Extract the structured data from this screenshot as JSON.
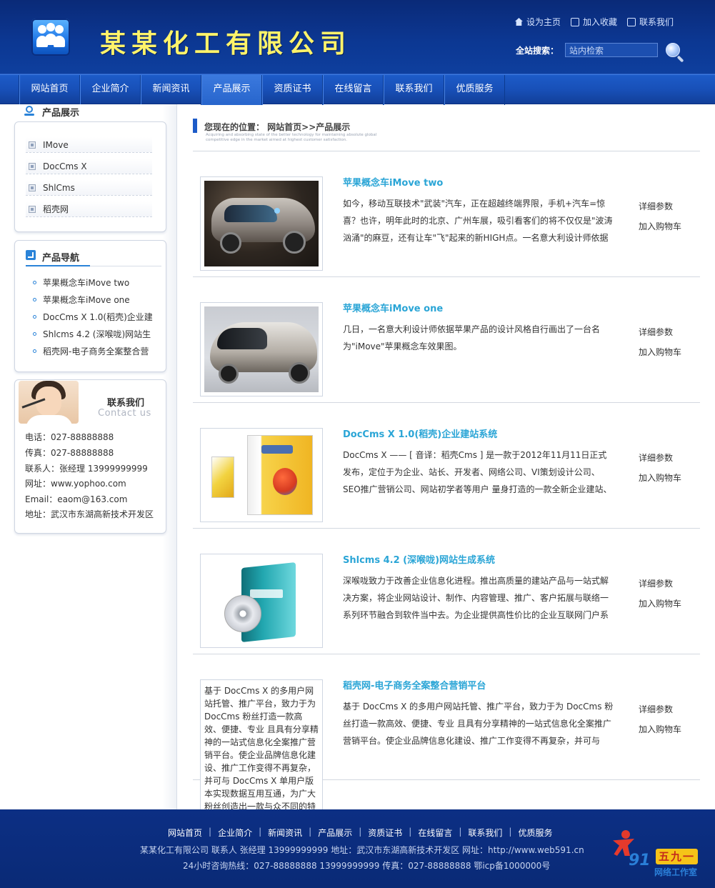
{
  "header": {
    "site_title": "某某化工有限公司",
    "top_links": [
      "设为主页",
      "加入收藏",
      "联系我们"
    ],
    "search_label": "全站搜索：",
    "search_placeholder": "站内检索"
  },
  "nav": {
    "items": [
      "网站首页",
      "企业简介",
      "新闻资讯",
      "产品展示",
      "资质证书",
      "在线留言",
      "联系我们",
      "优质服务"
    ],
    "active": "产品展示"
  },
  "sidebar": {
    "products_title": "产品展示",
    "categories": [
      "IMove",
      "DocCms X",
      "ShlCms",
      "稻壳网"
    ],
    "nav_title": "产品导航",
    "nav_items": [
      "苹果概念车iMove two",
      "苹果概念车iMove one",
      "DocCms X 1.0(稻壳)企业建",
      "Shlcms 4.2 (深喉咙)网站生",
      "稻壳网-电子商务全案整合营"
    ],
    "contact_title": "联系我们",
    "contact_subtitle": "Contact us",
    "contact_lines": [
      "电话：027-88888888",
      "传真：027-88888888",
      "联系人：张经理 13999999999",
      "网址：www.yophoo.com",
      "Email：eaom@163.com",
      "地址：武汉市东湖高新技术开发区"
    ]
  },
  "main": {
    "breadcrumb": "您现在的位置： 网站首页>>产品展示",
    "tagline": "Acquiring and absorbing state of the better technology for maintaining absolute global competitive edge in the market aimed at highest customer satisfaction.",
    "detail_label": "详细参数",
    "cart_label": "加入购物车",
    "products": [
      {
        "title": "苹果概念车iMove two",
        "desc": "如今，移动互联技术\"武装\"汽车，正在超越终端界限，手机+汽车=惊喜？也许，明年此时的北京、广州车展，吸引看客们的将不仅仅是\"波涛汹涌\"的麻豆，还有让车\"飞\"起来的新HIGH点。一名意大利设计师依据"
      },
      {
        "title": "苹果概念车iMove one",
        "desc": "几日，一名意大利设计师依据苹果产品的设计风格自行画出了一台名为\"iMove\"苹果概念车效果图。"
      },
      {
        "title": "DocCms X 1.0(稻壳)企业建站系统",
        "desc": "DocCms X —— [ 音译：稻壳Cms ] 是一款于2012年11月11日正式发布，定位于为企业、站长、开发者、网络公司、VI策划设计公司、SEO推广营销公司、网站初学者等用户 量身打造的一款全新企业建站、内容"
      },
      {
        "title": "Shlcms 4.2 (深喉咙)网站生成系统",
        "desc": "深喉咙致力于改善企业信息化进程。推出高质量的建站产品与一站式解决方案，将企业网站设计、制作、内容管理、推广、客户拓展与联络一系列环节融合到软件当中去。为企业提供高性价比的企业互联网门户系"
      },
      {
        "title": "稻壳网-电子商务全案整合营销平台",
        "desc": "基于 DocCms X 的多用户网站托管、推广平台，致力于为 DocCms 粉丝打造一款高效、便捷、专业 且具有分享精神的一站式信息化全案推广营销平台。使企业品牌信息化建设、推广工作变得不再复杂，并可与"
      }
    ],
    "image_text": "基于 DocCms X 的多用户网站托管、推广平台，致力于为 DocCms 粉丝打造一款高效、便捷、专业 且具有分享精神的一站式信息化全案推广营销平台。使企业品牌信息化建设、推广工作变得不再复杂，并可与 DocCms X 单用户版本实现数据互用互通，为广大粉丝创造出一款与众不同的特色"
  },
  "footer": {
    "nav_items": [
      "网站首页",
      "企业简介",
      "新闻资讯",
      "产品展示",
      "资质证书",
      "在线留言",
      "联系我们",
      "优质服务"
    ],
    "separator": "|",
    "line1": "某某化工有限公司 联系人 张经理 13999999999 地址：武汉市东湖高新技术开发区 网址：http://www.web591.cn",
    "line2": "24小时咨询热线：027-88888888 13999999999 传真：027-88888888 鄂icp备1000000号",
    "studio_number": "91",
    "studio_cn": "五九一",
    "studio_name": "网络工作室"
  },
  "colors": {
    "header_bg": "#0c3792",
    "nav_bg": "#1850b8",
    "title_yellow": "#fff36a",
    "product_title": "#2aa5d6",
    "accent_blue": "#2a83d8"
  }
}
